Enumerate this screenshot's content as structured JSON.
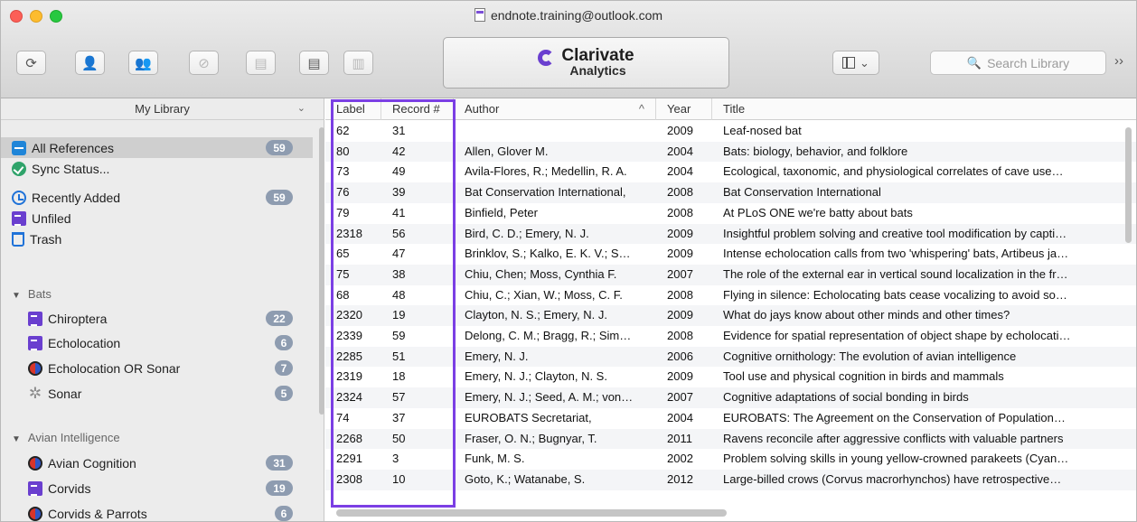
{
  "window": {
    "title": "endnote.training@outlook.com"
  },
  "toolbar": {
    "buttons": [
      "sync-icon",
      "add-user-icon",
      "shared-group-icon",
      "find-full-text-icon",
      "export-icon",
      "new-reference-icon",
      "insert-citation-icon"
    ],
    "brand_name": "Clarivate",
    "brand_sub": "Analytics",
    "layout_chevron": "⌄",
    "search_placeholder": "Search Library",
    "overflow": "››"
  },
  "sidebar": {
    "header": "My Library",
    "items": [
      {
        "label": "All References",
        "count": "59",
        "icon": "all-references-icon"
      },
      {
        "label": "Sync Status...",
        "count": "",
        "icon": "sync-status-icon"
      },
      {
        "label": "Recently Added",
        "count": "59",
        "icon": "recently-added-icon"
      },
      {
        "label": "Unfiled",
        "count": "",
        "icon": "unfiled-icon"
      },
      {
        "label": "Trash",
        "count": "",
        "icon": "trash-icon"
      }
    ],
    "group1": {
      "name": "Bats",
      "items": [
        {
          "label": "Chiroptera",
          "count": "22"
        },
        {
          "label": "Echolocation",
          "count": "6"
        },
        {
          "label": "Echolocation OR Sonar",
          "count": "7"
        },
        {
          "label": "Sonar",
          "count": "5"
        }
      ]
    },
    "group2": {
      "name": "Avian Intelligence",
      "items": [
        {
          "label": "Avian Cognition",
          "count": "31"
        },
        {
          "label": "Corvids",
          "count": "19"
        },
        {
          "label": "Corvids & Parrots",
          "count": "6"
        }
      ]
    }
  },
  "table": {
    "columns": {
      "label": "Label",
      "record": "Record #",
      "author": "Author",
      "year": "Year",
      "title": "Title",
      "sort_indicator": "^"
    },
    "rows": [
      {
        "label": "62",
        "record": "31",
        "author": "",
        "year": "2009",
        "title": "Leaf-nosed bat"
      },
      {
        "label": "80",
        "record": "42",
        "author": "Allen, Glover M.",
        "year": "2004",
        "title": "Bats: biology, behavior, and folklore"
      },
      {
        "label": "73",
        "record": "49",
        "author": "Avila-Flores, R.; Medellin, R. A.",
        "year": "2004",
        "title": "Ecological, taxonomic, and physiological correlates of cave use…"
      },
      {
        "label": "76",
        "record": "39",
        "author": "Bat Conservation International,",
        "year": "2008",
        "title": "Bat Conservation International"
      },
      {
        "label": "79",
        "record": "41",
        "author": "Binfield, Peter",
        "year": "2008",
        "title": "At PLoS ONE we're batty about bats"
      },
      {
        "label": "2318",
        "record": "56",
        "author": "Bird, C. D.; Emery, N. J.",
        "year": "2009",
        "title": "Insightful problem solving and creative tool modification by capti…"
      },
      {
        "label": "65",
        "record": "47",
        "author": "Brinklov, S.; Kalko, E. K. V.; S…",
        "year": "2009",
        "title": "Intense echolocation calls from two 'whispering' bats, Artibeus ja…"
      },
      {
        "label": "75",
        "record": "38",
        "author": "Chiu, Chen; Moss, Cynthia F.",
        "year": "2007",
        "title": "The role of the external ear in vertical sound localization in the fr…"
      },
      {
        "label": "68",
        "record": "48",
        "author": "Chiu, C.; Xian, W.; Moss, C. F.",
        "year": "2008",
        "title": "Flying in silence: Echolocating bats cease vocalizing to avoid so…"
      },
      {
        "label": "2320",
        "record": "19",
        "author": "Clayton, N. S.; Emery, N. J.",
        "year": "2009",
        "title": "What do jays know about other minds and other times?"
      },
      {
        "label": "2339",
        "record": "59",
        "author": "Delong, C. M.; Bragg, R.; Sim…",
        "year": "2008",
        "title": "Evidence for spatial representation of object shape by echolocati…"
      },
      {
        "label": "2285",
        "record": "51",
        "author": "Emery, N. J.",
        "year": "2006",
        "title": "Cognitive ornithology: The evolution of avian intelligence"
      },
      {
        "label": "2319",
        "record": "18",
        "author": "Emery, N. J.; Clayton, N. S.",
        "year": "2009",
        "title": "Tool use and physical cognition in birds and mammals"
      },
      {
        "label": "2324",
        "record": "57",
        "author": "Emery, N. J.; Seed, A. M.; von…",
        "year": "2007",
        "title": "Cognitive adaptations of social bonding in birds"
      },
      {
        "label": "74",
        "record": "37",
        "author": "EUROBATS Secretariat,",
        "year": "2004",
        "title": "EUROBATS: The Agreement on the Conservation of Population…"
      },
      {
        "label": "2268",
        "record": "50",
        "author": "Fraser, O. N.; Bugnyar, T.",
        "year": "2011",
        "title": "Ravens reconcile after aggressive conflicts with valuable partners"
      },
      {
        "label": "2291",
        "record": "3",
        "author": "Funk, M. S.",
        "year": "2002",
        "title": "Problem solving skills in young yellow-crowned parakeets (Cyan…"
      },
      {
        "label": "2308",
        "record": "10",
        "author": "Goto, K.; Watanabe, S.",
        "year": "2012",
        "title": "Large-billed crows (Corvus macrorhynchos) have retrospective…"
      }
    ]
  },
  "colors": {
    "highlight": "#7b3fe4",
    "badge": "#8e9cb0",
    "brand": "#6a3fcf"
  }
}
